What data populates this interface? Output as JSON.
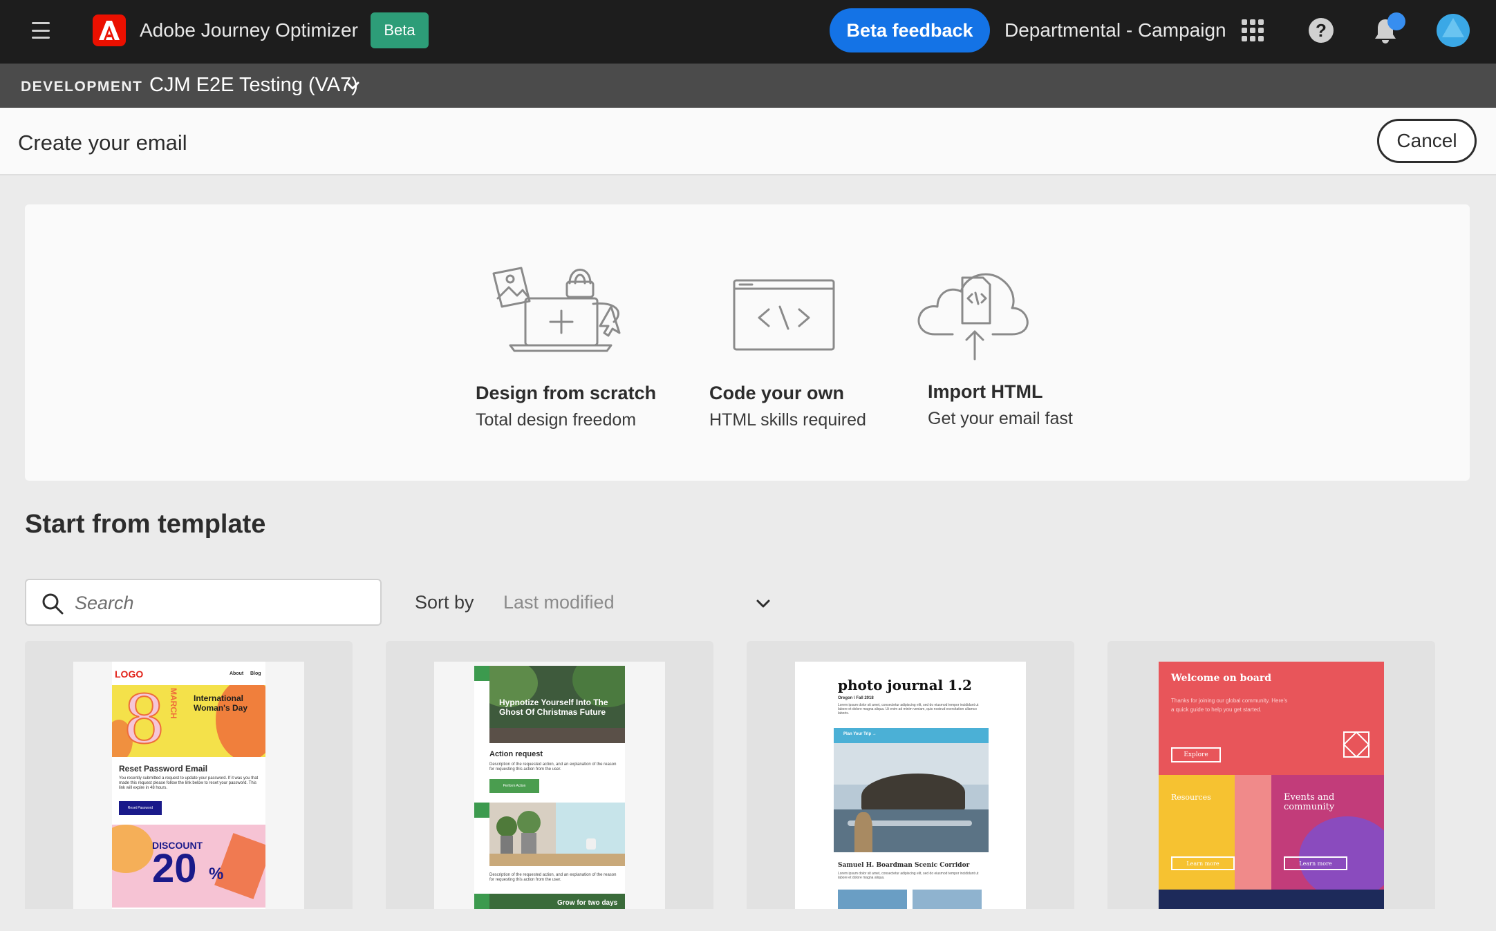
{
  "topbar": {
    "app_title": "Adobe Journey Optimizer",
    "beta_badge": "Beta",
    "beta_feedback": "Beta feedback",
    "org_name": "Departmental - Campaign",
    "help_glyph": "?"
  },
  "sandbox": {
    "env_label": "DEVELOPMENT",
    "name": "CJM E2E Testing (VA7)"
  },
  "header": {
    "title": "Create your email",
    "cancel": "Cancel"
  },
  "options": [
    {
      "title": "Design from scratch",
      "subtitle": "Total design freedom",
      "icon": "design-scratch-illustration"
    },
    {
      "title": "Code your own",
      "subtitle": "HTML skills required",
      "icon": "code-window-illustration"
    },
    {
      "title": "Import HTML",
      "subtitle": "Get your email fast",
      "icon": "cloud-upload-illustration"
    }
  ],
  "templates": {
    "section_title": "Start from template",
    "search_placeholder": "Search",
    "sort_label": "Sort by",
    "sort_value": "Last modified",
    "cards": [
      {
        "logo": "LOGO",
        "nav_about": "About",
        "nav_blog": "Blog",
        "hero_number": "8",
        "hero_month": "MARCH",
        "hero_text": "International Woman's Day",
        "heading": "Reset Password Email",
        "body": "You recently submitted a request to update your password. If it was you that made this request please follow the link below to reset your password. This link will expire in 48 hours.",
        "button": "Reset Password",
        "discount_label": "DISCOUNT",
        "discount_value": "20",
        "discount_pct": "%"
      },
      {
        "hero_text": "Hypnotize Yourself Into The Ghost Of Christmas Future",
        "heading": "Action request",
        "body": "Description of the requested action, and an explanation of the reason for requesting this action from the user.",
        "button": "Perform Action",
        "body2": "Description of the requested action, and an explanation of the reason for requesting this action from the user.",
        "footer_label": "Grow for two days"
      },
      {
        "title": "photo journal 1.2",
        "subtitle": "Oregon \\ Fall 2018",
        "body": "Lorem ipsum dolor sit amet, consectetur adipiscing elit, sed do eiusmod tempor incididunt ut labore et dolore magna aliqua. Ut enim ad minim veniam, quis nostrud exercitation ullamco laboris.",
        "bar_label": "Plan Your Trip →",
        "caption": "Samuel H. Boardman Scenic Corridor",
        "caption_body": "Lorem ipsum dolor sit amet, consectetur adipiscing elit, sed do eiusmod tempor incididunt ut labore et dolore magna aliqua."
      },
      {
        "title": "Welcome on board",
        "body": "Thanks for joining our global community. Here's a quick guide to help you get started.",
        "explore": "Explore",
        "resources": "Resources",
        "events": "Events and community",
        "learn_more_1": "Learn more",
        "learn_more_2": "Learn more"
      }
    ]
  },
  "colors": {
    "topbar_bg": "#1d1d1d",
    "sandbox_bg": "#4b4b4b",
    "accent_blue": "#1473e6",
    "beta_green": "#2d9d78",
    "adobe_red": "#eb1000"
  }
}
